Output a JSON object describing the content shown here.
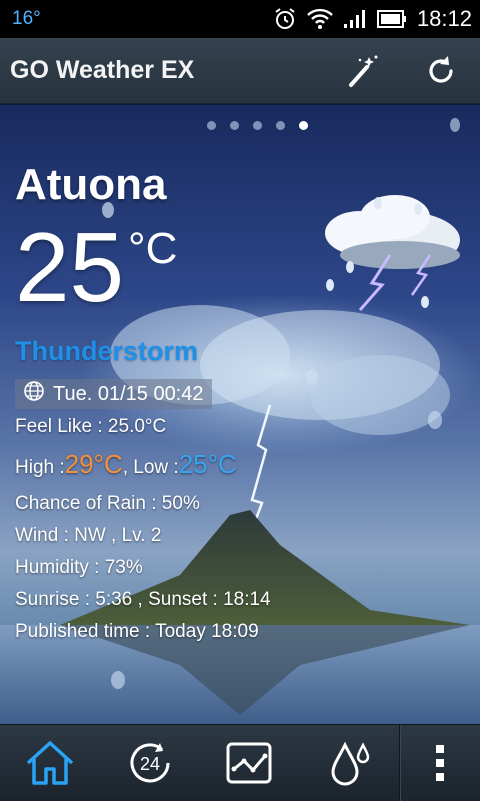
{
  "status_bar": {
    "temperature": "16°",
    "time": "18:12",
    "icons": [
      "alarm-icon",
      "wifi-icon",
      "signal-icon",
      "battery-icon"
    ]
  },
  "app_bar": {
    "title": "GO Weather EX",
    "actions": [
      "magic-wand-icon",
      "refresh-icon"
    ]
  },
  "pager": {
    "count": 5,
    "active_index": 4
  },
  "weather": {
    "city": "Atuona",
    "temperature": "25",
    "unit": "°C",
    "condition": "Thunderstorm",
    "datetime": "Tue. 01/15 00:42",
    "feel_like": "Feel Like : 25.0°C",
    "high_label": "High : ",
    "high_value": "29°C",
    "low_label": ", Low : ",
    "low_value": "25°C",
    "chance_of_rain": "Chance of Rain : 50%",
    "wind": "Wind : NW , Lv. 2",
    "humidity": "Humidity : 73%",
    "sun": "Sunrise : 5:36 , Sunset : 18:14",
    "published": "Published time : Today 18:09"
  },
  "bottom_nav": {
    "items": [
      "home-icon",
      "24-hour-icon",
      "trend-chart-icon",
      "precipitation-icon",
      "more-menu-icon"
    ],
    "active": "home-icon"
  },
  "colors": {
    "accent_blue": "#1e90e8",
    "high_orange": "#f2903d",
    "low_blue": "#3aa5ef",
    "status_temp": "#4fb3ff"
  }
}
